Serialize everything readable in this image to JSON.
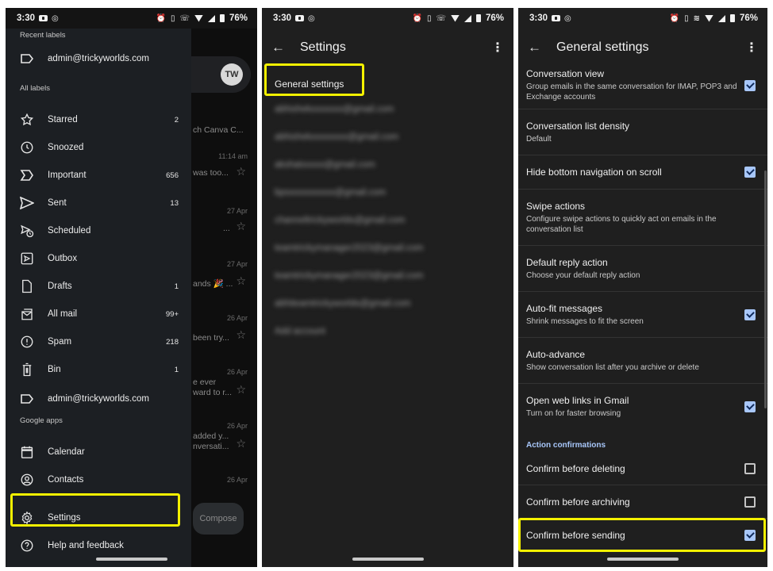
{
  "status_bar": {
    "time": "3:30",
    "battery": "76%"
  },
  "panel1": {
    "sections": {
      "recent_labels": "Recent labels",
      "all_labels": "All labels",
      "google_apps": "Google apps"
    },
    "recent_label_item": "admin@trickyworlds.com",
    "labels": [
      {
        "label": "Starred",
        "count": "2",
        "icon": "star-icon"
      },
      {
        "label": "Snoozed",
        "count": "",
        "icon": "clock-icon"
      },
      {
        "label": "Important",
        "count": "656",
        "icon": "important-icon"
      },
      {
        "label": "Sent",
        "count": "13",
        "icon": "send-icon"
      },
      {
        "label": "Scheduled",
        "count": "",
        "icon": "scheduled-icon"
      },
      {
        "label": "Outbox",
        "count": "",
        "icon": "outbox-icon"
      },
      {
        "label": "Drafts",
        "count": "1",
        "icon": "draft-icon"
      },
      {
        "label": "All mail",
        "count": "99+",
        "icon": "all-mail-icon"
      },
      {
        "label": "Spam",
        "count": "218",
        "icon": "spam-icon"
      },
      {
        "label": "Bin",
        "count": "1",
        "icon": "bin-icon"
      }
    ],
    "user_label_item": "admin@trickyworlds.com",
    "apps": [
      {
        "label": "Calendar",
        "icon": "calendar-icon"
      },
      {
        "label": "Contacts",
        "icon": "contacts-icon"
      }
    ],
    "footer": [
      {
        "label": "Settings",
        "icon": "gear-icon"
      },
      {
        "label": "Help and feedback",
        "icon": "help-icon"
      }
    ],
    "background": {
      "avatar_initials": "TW",
      "compose": "Compose",
      "snippets": [
        "ch Canva C...",
        "was too...",
        "...",
        "ands 🎉 ...",
        "been try...",
        "e ever",
        "ward to r...",
        "added y...",
        "nversati..."
      ],
      "dates": [
        "11:14 am",
        "27 Apr",
        "27 Apr",
        "26 Apr",
        "26 Apr",
        "26 Apr",
        "26 Apr"
      ]
    }
  },
  "panel2": {
    "title": "Settings",
    "general_settings": "General settings",
    "accounts": [
      "abhishekxxxxxxx@gmail.com",
      "abhishekxxxxxxxx@gmail.com",
      "akshatxxxxx@gmail.com",
      "bpsxxxxxxxxxx@gmail.com",
      "channeltrickyworlds@gmail.com",
      "teamtrickymanager2023@gmail.com",
      "teamtrickymanager2023@gmail.com",
      "abhiteamtrickyworlds@gmail.com",
      "Add account"
    ]
  },
  "panel3": {
    "title": "General settings",
    "rows": [
      {
        "title": "Conversation view",
        "subtitle": "Group emails in the same conversation for IMAP, POP3 and Exchange accounts",
        "checkbox": true
      },
      {
        "title": "Conversation list density",
        "subtitle": "Default",
        "checkbox": null
      },
      {
        "title": "Hide bottom navigation on scroll",
        "subtitle": "",
        "checkbox": true
      },
      {
        "title": "Swipe actions",
        "subtitle": "Configure swipe actions to quickly act on emails in the conversation list",
        "checkbox": null
      },
      {
        "title": "Default reply action",
        "subtitle": "Choose your default reply action",
        "checkbox": null
      },
      {
        "title": "Auto-fit messages",
        "subtitle": "Shrink messages to fit the screen",
        "checkbox": true
      },
      {
        "title": "Auto-advance",
        "subtitle": "Show conversation list after you archive or delete",
        "checkbox": null
      },
      {
        "title": "Open web links in Gmail",
        "subtitle": "Turn on for faster browsing",
        "checkbox": true
      }
    ],
    "section_header": "Action confirmations",
    "confirm_rows": [
      {
        "title": "Confirm before deleting",
        "checked": false
      },
      {
        "title": "Confirm before archiving",
        "checked": false
      },
      {
        "title": "Confirm before sending",
        "checked": true
      }
    ]
  },
  "colors": {
    "highlight": "#f4f100",
    "accent": "#a8c7fa",
    "drawer_bg": "#1c1f23",
    "panel_bg": "#1f1f1f"
  }
}
